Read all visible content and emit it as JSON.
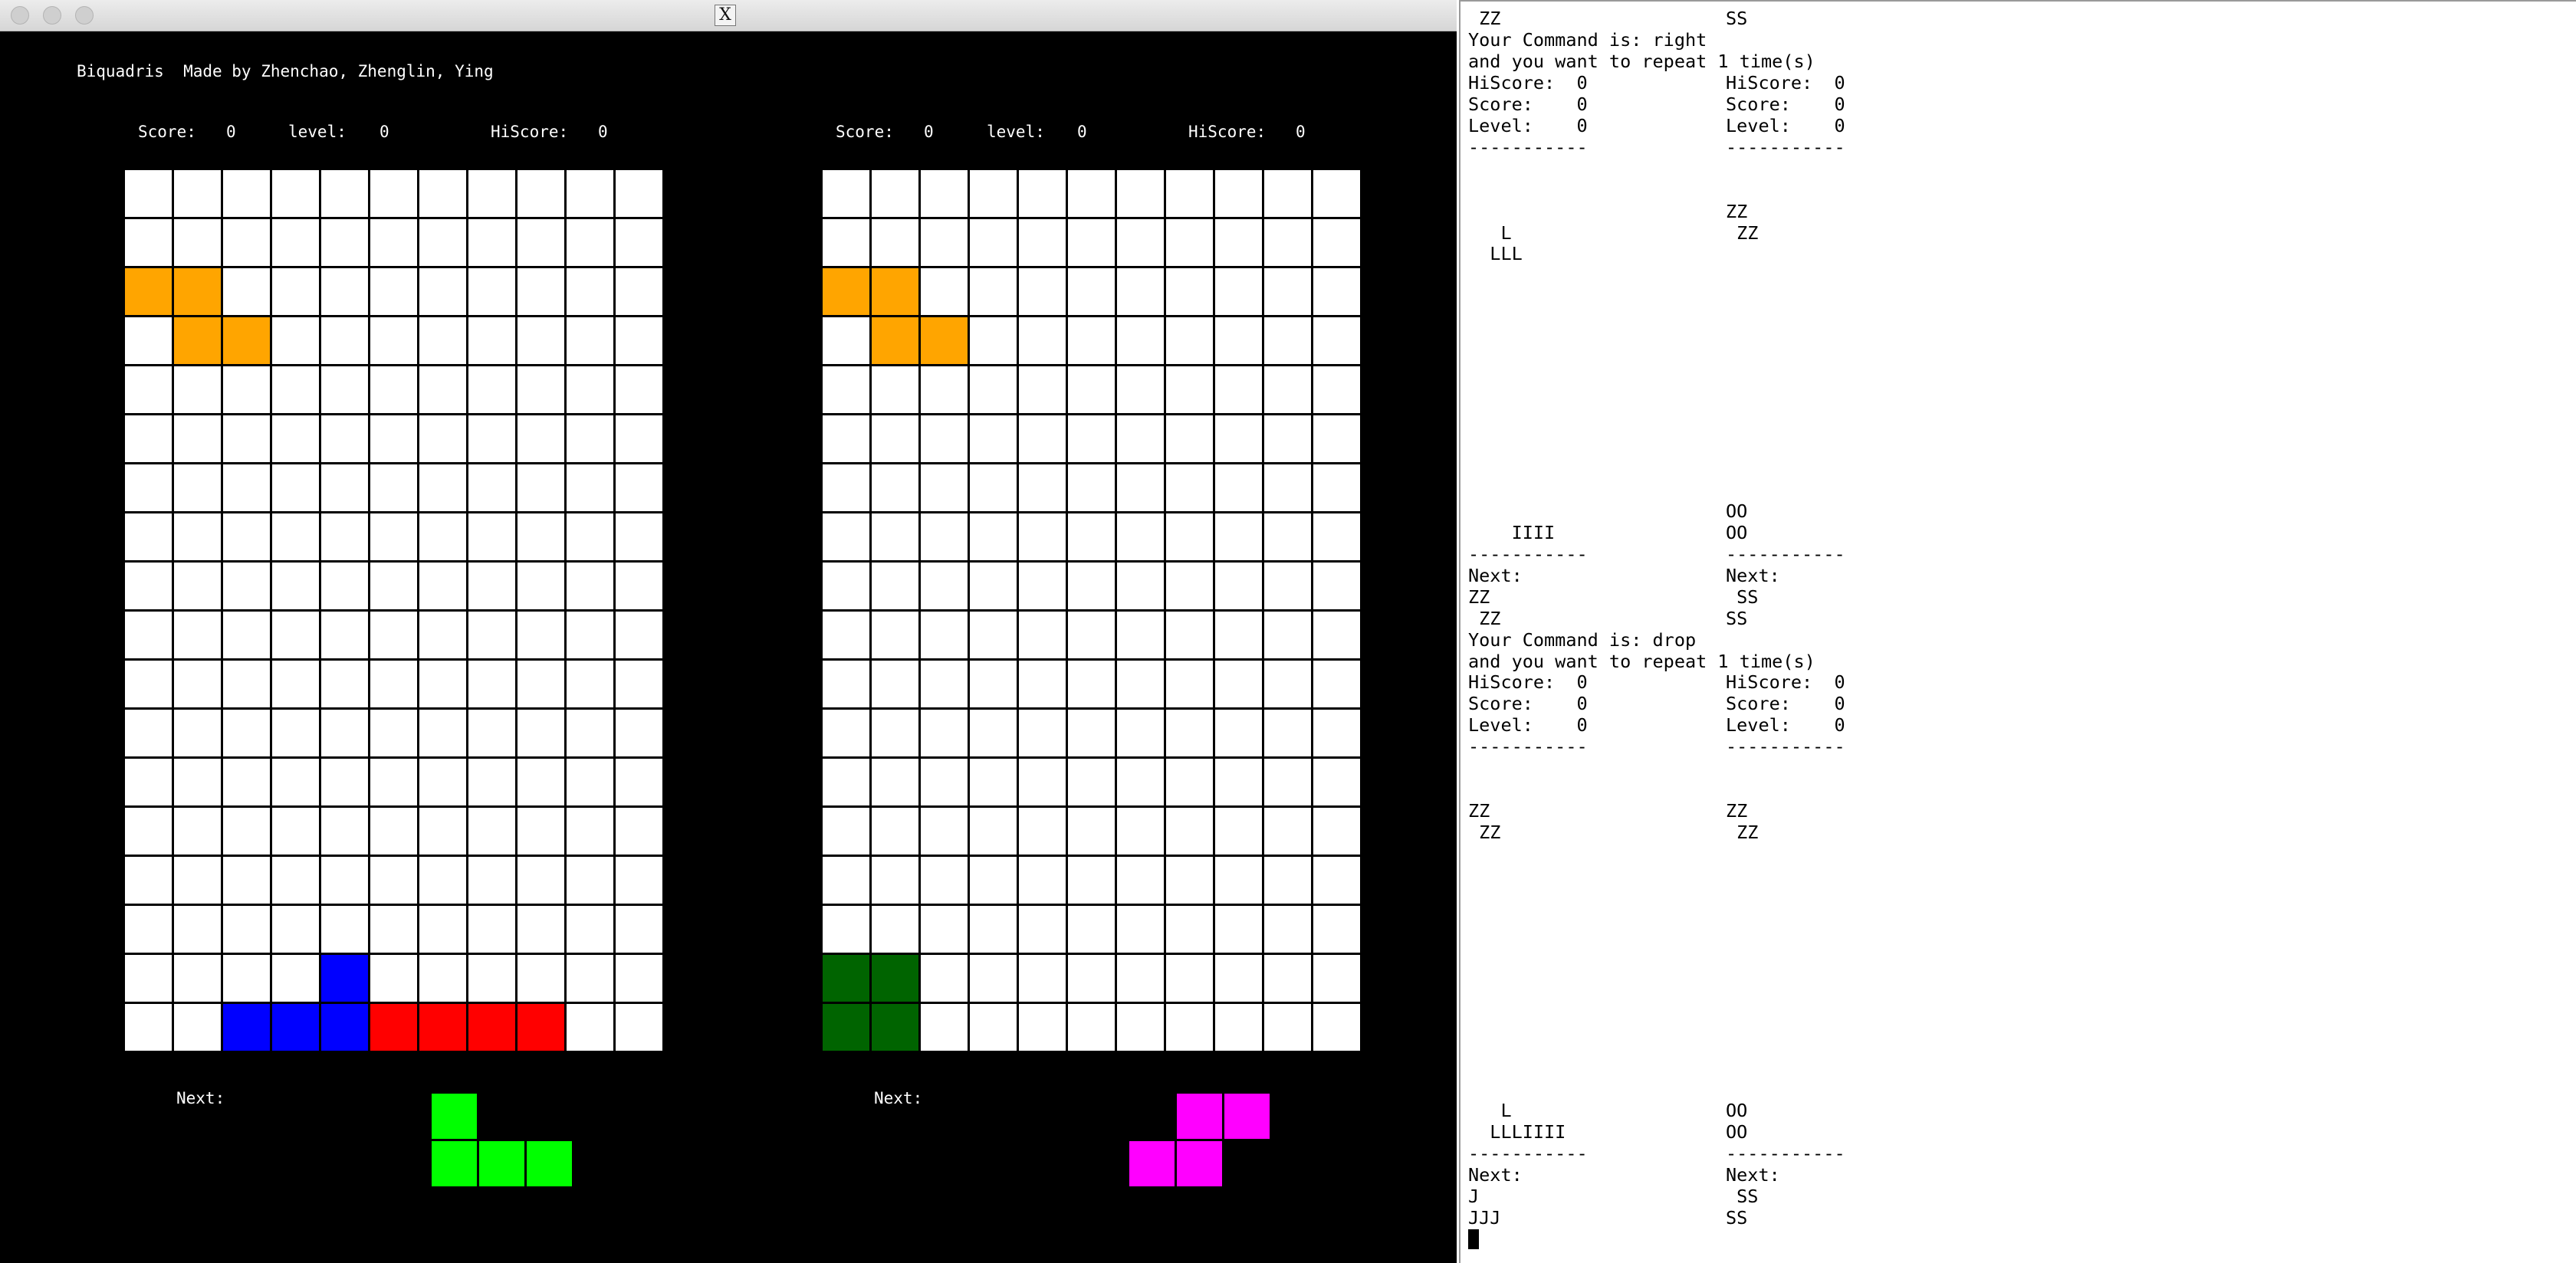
{
  "window": {
    "title_icon": "X"
  },
  "header": {
    "title": "Biquadris  Made by Zhenchao, Zhenglin, Ying"
  },
  "colors": {
    "orange": "#FFA500",
    "blue": "#0000FF",
    "red": "#FF0000",
    "dark_green": "#006400",
    "green": "#00FF00",
    "magenta": "#FF00FF",
    "empty": "#FFFFFF",
    "grid": "#000000"
  },
  "players": [
    {
      "score_label": "Score:",
      "score": "0",
      "level_label": "level:",
      "level": "0",
      "hiscore_label": "HiScore:",
      "hiscore": "0",
      "next_label": "Next:",
      "board": {
        "cols": 11,
        "rows": 18,
        "filled": [
          {
            "r": 2,
            "c": 0,
            "color": "orange"
          },
          {
            "r": 2,
            "c": 1,
            "color": "orange"
          },
          {
            "r": 3,
            "c": 1,
            "color": "orange"
          },
          {
            "r": 3,
            "c": 2,
            "color": "orange"
          },
          {
            "r": 16,
            "c": 4,
            "color": "blue"
          },
          {
            "r": 17,
            "c": 2,
            "color": "blue"
          },
          {
            "r": 17,
            "c": 3,
            "color": "blue"
          },
          {
            "r": 17,
            "c": 4,
            "color": "blue"
          },
          {
            "r": 17,
            "c": 5,
            "color": "red"
          },
          {
            "r": 17,
            "c": 6,
            "color": "red"
          },
          {
            "r": 17,
            "c": 7,
            "color": "red"
          },
          {
            "r": 17,
            "c": 8,
            "color": "red"
          }
        ]
      },
      "next_piece": {
        "color": "green",
        "cells": [
          {
            "r": 0,
            "c": 0
          },
          {
            "r": 1,
            "c": 0
          },
          {
            "r": 1,
            "c": 1
          },
          {
            "r": 1,
            "c": 2
          }
        ]
      }
    },
    {
      "score_label": "Score:",
      "score": "0",
      "level_label": "level:",
      "level": "0",
      "hiscore_label": "HiScore:",
      "hiscore": "0",
      "next_label": "Next:",
      "board": {
        "cols": 11,
        "rows": 18,
        "filled": [
          {
            "r": 2,
            "c": 0,
            "color": "orange"
          },
          {
            "r": 2,
            "c": 1,
            "color": "orange"
          },
          {
            "r": 3,
            "c": 1,
            "color": "orange"
          },
          {
            "r": 3,
            "c": 2,
            "color": "orange"
          },
          {
            "r": 16,
            "c": 0,
            "color": "dark_green"
          },
          {
            "r": 16,
            "c": 1,
            "color": "dark_green"
          },
          {
            "r": 17,
            "c": 0,
            "color": "dark_green"
          },
          {
            "r": 17,
            "c": 1,
            "color": "dark_green"
          }
        ]
      },
      "next_piece": {
        "color": "magenta",
        "cells": [
          {
            "r": 0,
            "c": 1
          },
          {
            "r": 0,
            "c": 2
          },
          {
            "r": 1,
            "c": 0
          },
          {
            "r": 1,
            "c": 1
          }
        ]
      }
    }
  ],
  "terminal": {
    "lines": [
      {
        "row": 0,
        "left": " ZZ",
        "right": "SS"
      },
      {
        "row": 1,
        "left": "Your Command is: right",
        "right": ""
      },
      {
        "row": 2,
        "left": "and you want to repeat 1 time(s)",
        "right": ""
      },
      {
        "row": 3,
        "left": "HiScore:  0",
        "right": "HiScore:  0"
      },
      {
        "row": 4,
        "left": "Score:    0",
        "right": "Score:    0"
      },
      {
        "row": 5,
        "left": "Level:    0",
        "right": "Level:    0"
      },
      {
        "row": 6,
        "left": "-----------",
        "right": "-----------"
      },
      {
        "row": 9,
        "left": "",
        "right": "ZZ"
      },
      {
        "row": 10,
        "left": "   L",
        "right": " ZZ"
      },
      {
        "row": 11,
        "left": "  LLL",
        "right": ""
      },
      {
        "row": 23,
        "left": "",
        "right": "OO"
      },
      {
        "row": 24,
        "left": "    IIII",
        "right": "OO"
      },
      {
        "row": 25,
        "left": "-----------",
        "right": "-----------"
      },
      {
        "row": 26,
        "left": "Next:",
        "right": "Next:"
      },
      {
        "row": 27,
        "left": "ZZ",
        "right": " SS"
      },
      {
        "row": 28,
        "left": " ZZ",
        "right": "SS"
      },
      {
        "row": 29,
        "left": "Your Command is: drop",
        "right": ""
      },
      {
        "row": 30,
        "left": "and you want to repeat 1 time(s)",
        "right": ""
      },
      {
        "row": 31,
        "left": "HiScore:  0",
        "right": "HiScore:  0"
      },
      {
        "row": 32,
        "left": "Score:    0",
        "right": "Score:    0"
      },
      {
        "row": 33,
        "left": "Level:    0",
        "right": "Level:    0"
      },
      {
        "row": 34,
        "left": "-----------",
        "right": "-----------"
      },
      {
        "row": 37,
        "left": "ZZ",
        "right": "ZZ"
      },
      {
        "row": 38,
        "left": " ZZ",
        "right": " ZZ"
      },
      {
        "row": 51,
        "left": "   L",
        "right": "OO"
      },
      {
        "row": 52,
        "left": "  LLLIIII",
        "right": "OO"
      },
      {
        "row": 53,
        "left": "-----------",
        "right": "-----------"
      },
      {
        "row": 54,
        "left": "Next:",
        "right": "Next:"
      },
      {
        "row": 55,
        "left": "J",
        "right": " SS"
      },
      {
        "row": 56,
        "left": "JJJ",
        "right": "SS"
      }
    ]
  }
}
